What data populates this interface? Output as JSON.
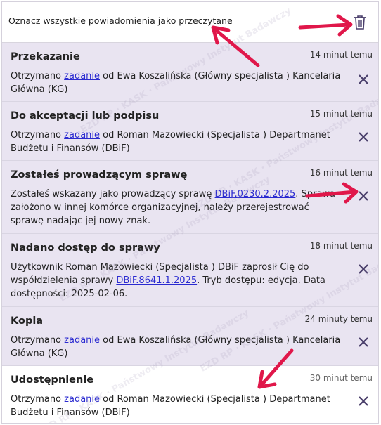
{
  "header": {
    "mark_all_label": "Oznacz wszystkie powiadomienia jako przeczytane",
    "delete_icon": "trash-icon"
  },
  "notifications": [
    {
      "title": "Przekazanie",
      "time": "14 minut temu",
      "text_before": "Otrzymano ",
      "link": "zadanie",
      "text_after": " od Ewa Koszalińska (Główny specjalista ) Kancelaria Główna (KG)"
    },
    {
      "title": "Do akceptacji lub podpisu",
      "time": "15 minut temu",
      "text_before": "Otrzymano ",
      "link": "zadanie",
      "text_after": " od Roman Mazowiecki (Specjalista ) Departmanet Budżetu i Finansów (DBiF)"
    },
    {
      "title": "Zostałeś prowadzącym sprawę",
      "time": "16 minut temu",
      "text_before": "Zostałeś wskazany jako prowadzący sprawę ",
      "link": "DBiF.0230.2.2025",
      "text_after": ". Sprawa założono w innej komórce organizacyjnej, należy przerejestrować sprawę nadając jej nowy znak."
    },
    {
      "title": "Nadano dostęp do sprawy",
      "time": "18 minut temu",
      "text_before": "Użytkownik Roman Mazowiecki (Specjalista ) DBiF zaprosił Cię do współdzielenia sprawy ",
      "link": "DBiF.8641.1.2025",
      "text_after": ". Tryb dostępu: edycja. Data dostępności: 2025-02-06."
    },
    {
      "title": "Kopia",
      "time": "24 minuty temu",
      "text_before": "Otrzymano ",
      "link": "zadanie",
      "text_after": " od Ewa Koszalińska (Główny specjalista ) Kancelaria Główna (KG)"
    },
    {
      "title": "Udostępnienie",
      "time": "30 minut temu",
      "text_before": "Otrzymano ",
      "link": "zadanie",
      "text_after": " od Roman Mazowiecki (Specjalista ) Departmanet Budżetu i Finansów (DBiF)"
    }
  ],
  "watermark_text": "EZD RP · KASK · Państwowy Instytut Badawczy",
  "colors": {
    "unread_bg": "#e9e4f1",
    "read_bg": "#ffffff",
    "close_x": "#4a3f6b",
    "link": "#2a2ad0",
    "annotation_arrow": "#e0174a"
  }
}
